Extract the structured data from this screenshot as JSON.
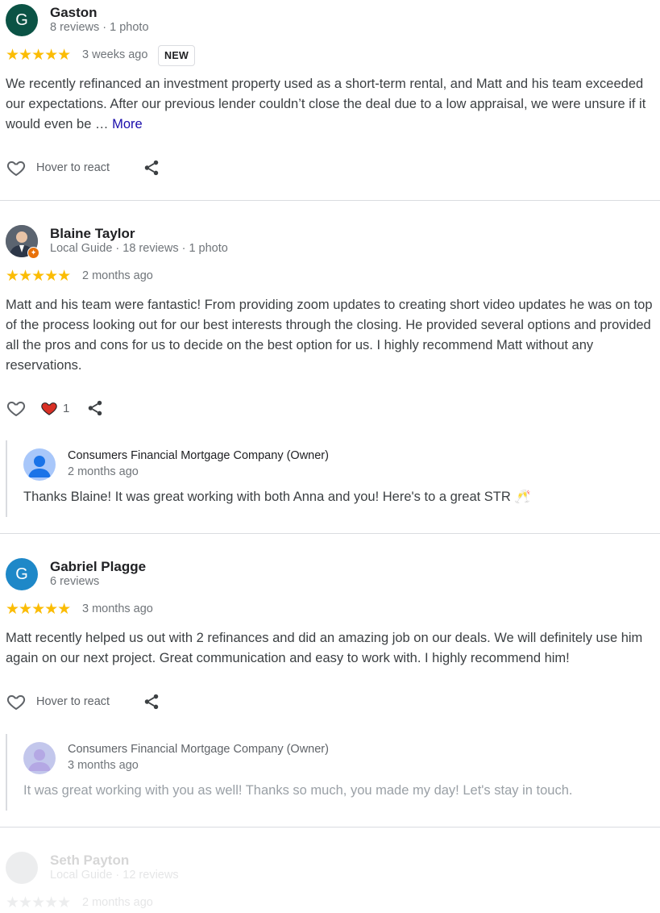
{
  "reviews": [
    {
      "avatar_letter": "G",
      "avatar_color": "#0b5345",
      "name": "Gaston",
      "meta": "8 reviews · 1 photo",
      "stars": "★★★★★",
      "when": "3 weeks ago",
      "badge": "NEW",
      "text": "We recently refinanced an investment property used as a short-term rental, and Matt and his team exceeded our expectations. After our previous lender couldn’t close the deal due to a low appraisal, we were unsure if it would even be …",
      "more_label": "More",
      "react_label": "Hover to react"
    },
    {
      "name": "Blaine Taylor",
      "meta": "Local Guide · 18 reviews · 1 photo",
      "stars": "★★★★★",
      "when": "2 months ago",
      "text": "Matt and his team were fantastic! From providing zoom updates to creating short video updates he was on top of the process looking out for our best interests through the closing. He provided several options and provided all the pros and cons for us to decide on the best option for us. I highly recommend Matt without any reservations.",
      "reaction_count": "1",
      "owner_response": {
        "name": "Consumers Financial Mortgage Company (Owner)",
        "date": "2 months ago",
        "text": "Thanks Blaine! It was great working with both Anna and you! Here's to a great STR 🥂"
      }
    },
    {
      "avatar_letter": "G",
      "avatar_color": "#1e88c8",
      "name": "Gabriel Plagge",
      "meta": "6 reviews",
      "stars": "★★★★★",
      "when": "3 months ago",
      "text": "Matt recently helped us out with 2 refinances and did an amazing job on our deals. We will definitely use him again on our next project. Great communication and easy to work with. I highly recommend him!",
      "react_label": "Hover to react",
      "owner_response": {
        "name": "Consumers Financial Mortgage Company (Owner)",
        "date": "3 months ago",
        "text": "It was great working with you as well! Thanks so much, you made my day! Let's stay in touch."
      }
    },
    {
      "name": "Seth Payton",
      "meta": "Local Guide · 12 reviews",
      "stars": "★★★★★",
      "when": "2 months ago"
    }
  ]
}
